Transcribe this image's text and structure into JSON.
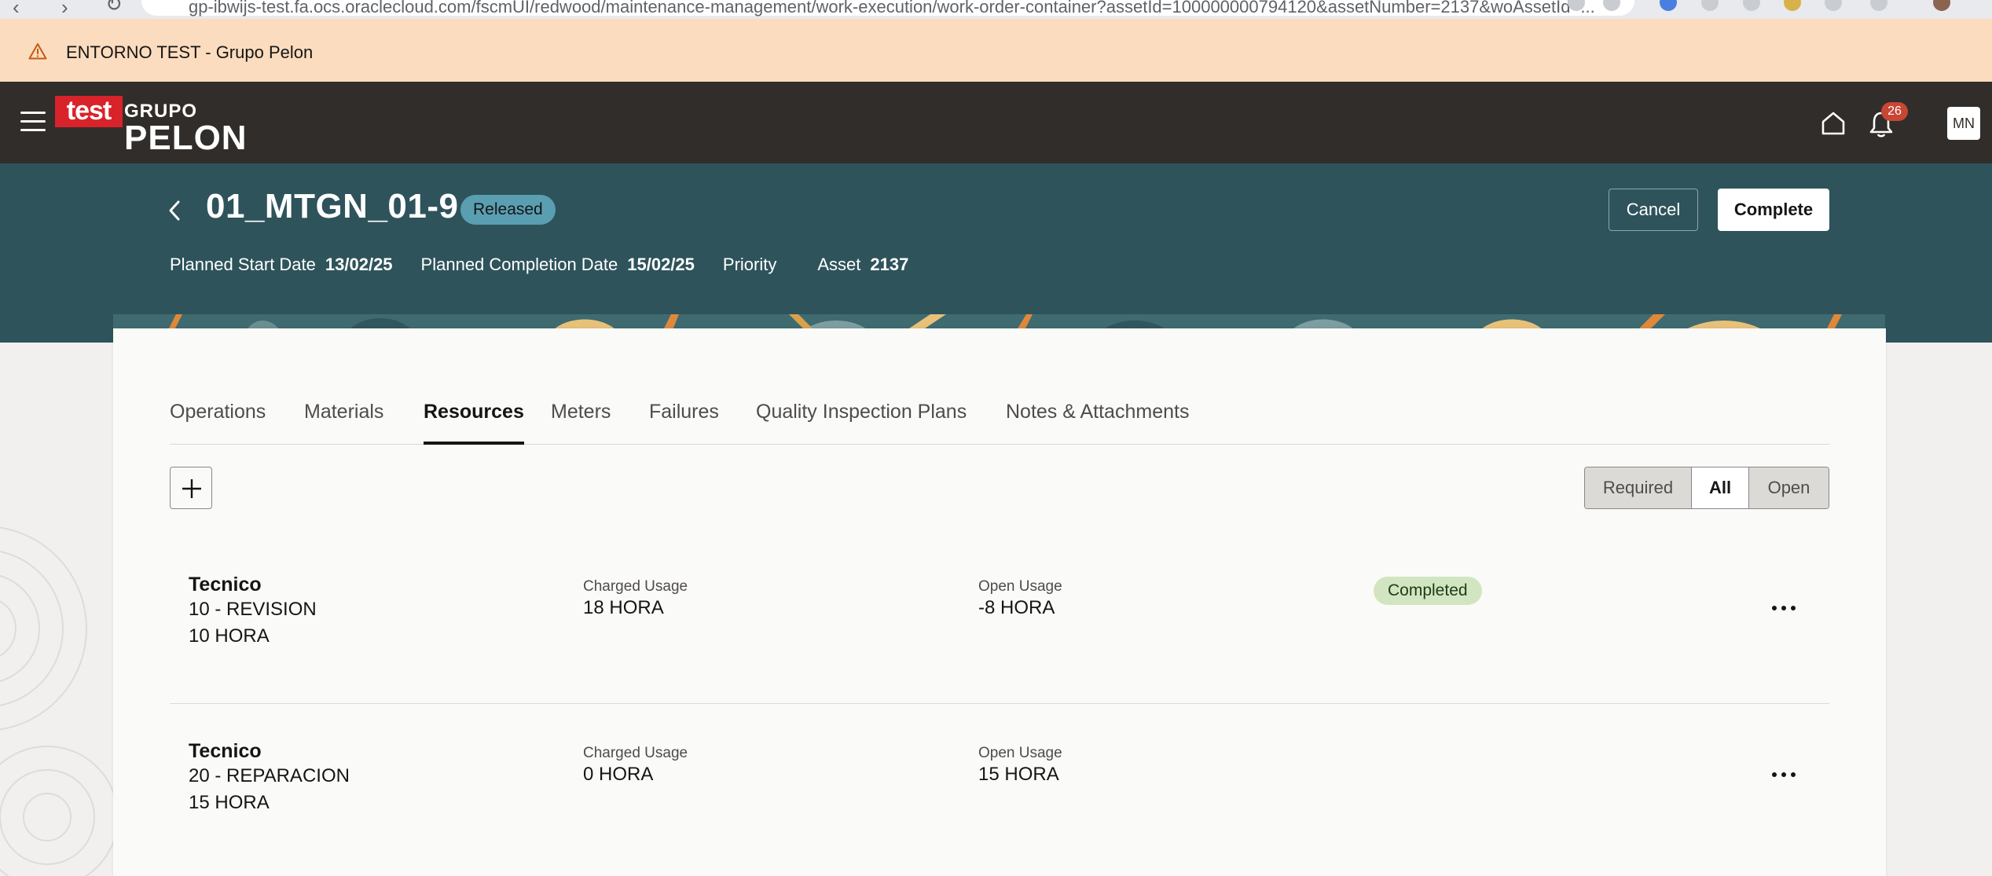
{
  "browser": {
    "url": "gp-ibwijs-test.fa.ocs.oraclecloud.com/fscmUI/redwood/maintenance-management/work-execution/work-order-container?assetId=100000000794120&assetNumber=2137&woAssetId=..."
  },
  "env_banner": {
    "text": "ENTORNO TEST - Grupo Pelon"
  },
  "header": {
    "logo_test": "test",
    "logo_grupo": "GRUPO",
    "logo_pelon": "PELON",
    "notifications_count": "26",
    "avatar_initials": "MN"
  },
  "work_order": {
    "title": "01_MTGN_01-9",
    "status": "Released",
    "planned_start_label": "Planned Start Date",
    "planned_start_value": "13/02/25",
    "planned_completion_label": "Planned Completion Date",
    "planned_completion_value": "15/02/25",
    "priority_label": "Priority",
    "asset_label": "Asset",
    "asset_value": "2137",
    "cancel_label": "Cancel",
    "complete_label": "Complete"
  },
  "tabs": [
    {
      "label": "Operations"
    },
    {
      "label": "Materials"
    },
    {
      "label": "Resources"
    },
    {
      "label": "Meters"
    },
    {
      "label": "Failures"
    },
    {
      "label": "Quality Inspection Plans"
    },
    {
      "label": "Notes & Attachments"
    }
  ],
  "active_tab": "Resources",
  "filter": {
    "required": "Required",
    "all": "All",
    "open": "Open",
    "selected": "All"
  },
  "resources": [
    {
      "name": "Tecnico",
      "operation": "10 - REVISION",
      "quantity": "10 HORA",
      "charged_label": "Charged Usage",
      "charged_value": "18 HORA",
      "open_label": "Open Usage",
      "open_value": "-8 HORA",
      "status": "Completed"
    },
    {
      "name": "Tecnico",
      "operation": "20 - REPARACION",
      "quantity": "15 HORA",
      "charged_label": "Charged Usage",
      "charged_value": "0 HORA",
      "open_label": "Open Usage",
      "open_value": "15 HORA",
      "status": ""
    }
  ],
  "colors": {
    "banner": "#fbdcbf",
    "app_header": "#312d2a",
    "page_band": "#2e535b",
    "status_released": "#5a9eb2",
    "status_completed": "#d1e6c0",
    "badge": "#c74634"
  }
}
